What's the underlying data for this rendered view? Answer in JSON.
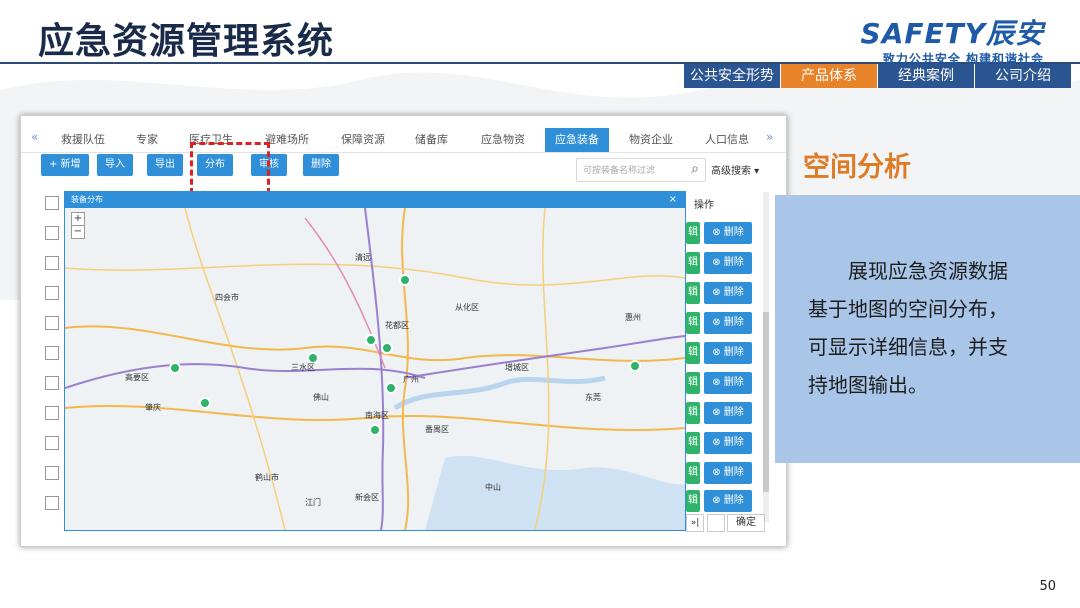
{
  "header": {
    "title": "应急资源管理系统"
  },
  "logo": {
    "brand": "SAFETY辰安",
    "slogan": "致力公共安全 构建和谐社会"
  },
  "topnav": [
    "公共安全形势",
    "产品体系",
    "经典案例",
    "公司介绍"
  ],
  "app": {
    "tabs": [
      "救援队伍",
      "专家",
      "医疗卫生",
      "避难场所",
      "保障资源",
      "储备库",
      "应急物资",
      "应急装备",
      "物资企业",
      "人口信息"
    ],
    "active_tab": "应急装备",
    "toolbar": {
      "add": "+ 新增",
      "import": "导入",
      "export": "导出",
      "distribution": "分布",
      "audit": "审核",
      "delete": "删除"
    },
    "search": {
      "placeholder": "可按装备名称过滤"
    },
    "advanced_search": "高级搜索",
    "column_operation": "操作",
    "row_actions": {
      "edit": "辑",
      "delete": "删除"
    },
    "map_window": {
      "title": "装备分布",
      "zoom_in": "+",
      "zoom_out": "−",
      "close": "×",
      "cities": [
        "广州",
        "佛山",
        "东莞",
        "清远",
        "四会市",
        "花都区",
        "从化区",
        "增城区",
        "番禺区",
        "南海区",
        "三水区",
        "新会区",
        "惠州",
        "肇庆",
        "高要区",
        "鹤山市",
        "中山",
        "江门"
      ]
    },
    "footer": {
      "confirm": "确定",
      "pager": "»|"
    }
  },
  "right": {
    "title": "空间分析",
    "body": [
      "展现应急资源数据",
      "基于地图的空间分布，",
      "可显示详细信息，并支",
      "持地图输出。"
    ]
  },
  "page_number": "50",
  "colors": {
    "accent_orange": "#e07b25",
    "nav_blue": "#2a5590",
    "panel_blue": "#a9c6e8",
    "app_blue": "#2f8fd8",
    "action_green": "#2fb36b"
  }
}
